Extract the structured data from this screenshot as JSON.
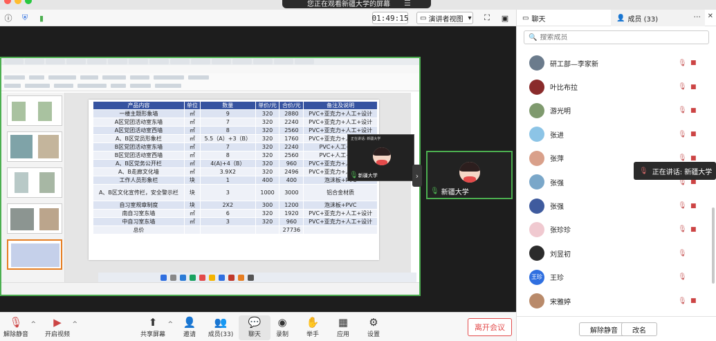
{
  "banner": {
    "text": "您正在观看新疆大学的屏幕"
  },
  "top": {
    "timer": "01:49:15",
    "view_mode": "演讲者视图"
  },
  "slide_table": {
    "headers": [
      "产品内容",
      "单位",
      "数量",
      "单价/元",
      "合价/元",
      "备注及说明"
    ],
    "rows": [
      [
        "一楼主题形象墙",
        "㎡",
        "9",
        "320",
        "2880",
        "PVC+亚克力+人工+设计"
      ],
      [
        "A区党团活动室东墙",
        "㎡",
        "7",
        "320",
        "2240",
        "PVC+亚克力+人工+设计"
      ],
      [
        "A区党团活动室西墙",
        "㎡",
        "8",
        "320",
        "2560",
        "PVC+亚克力+人工+设计"
      ],
      [
        "A、B区党员形象栏",
        "㎡",
        "5.5（A）+3（B）",
        "320",
        "1760",
        "PVC+亚克力+人工+设计"
      ],
      [
        "B区党团活动室东墙",
        "㎡",
        "7",
        "320",
        "2240",
        "PVC+人工+设计"
      ],
      [
        "B区党团活动室西墙",
        "㎡",
        "8",
        "320",
        "2560",
        "PVC+人工+设计"
      ],
      [
        "A、B区党务公开栏",
        "㎡",
        "4(A)+4（B）",
        "320",
        "960",
        "PVC+亚克力+人工+设计"
      ],
      [
        "A、B走廊文化墙",
        "㎡",
        "3.9X2",
        "320",
        "2496",
        "PVC+亚克力+人工+设计"
      ],
      [
        "工作人员形象栏",
        "块",
        "1",
        "400",
        "400",
        "泡沫板+PVC"
      ],
      [
        "A、B区文化宣传栏，安全警示栏",
        "块",
        "3",
        "1000",
        "3000",
        "铝合金材质"
      ],
      [
        "自习室规章制度",
        "块",
        "2X2",
        "300",
        "1200",
        "泡沫板+PVC"
      ],
      [
        "南自习室东墙",
        "㎡",
        "6",
        "320",
        "1920",
        "PVC+亚克力+人工+设计"
      ],
      [
        "中自习室东墙",
        "㎡",
        "3",
        "320",
        "960",
        "PVC+亚克力+人工+设计"
      ],
      [
        "总价",
        "",
        "",
        "",
        "27736",
        ""
      ]
    ]
  },
  "mini_cam": {
    "label": "正在讲话: 新疆大学",
    "name": "新疆大学"
  },
  "cam_tile": {
    "name": "新疆大学"
  },
  "toolbar": {
    "unmute": "解除静音",
    "video": "开启视频",
    "share": "共享屏幕",
    "invite": "邀请",
    "members": "成员(33)",
    "chat": "聊天",
    "record": "录制",
    "hand": "举手",
    "apps": "应用",
    "settings": "设置",
    "leave": "离开会议"
  },
  "side": {
    "tab_chat": "聊天",
    "tab_members": "成员 (33)",
    "search_placeholder": "搜索成员",
    "members": [
      {
        "name": "研工部—李家新",
        "color": "#6b7b8c"
      },
      {
        "name": "叶比布拉",
        "color": "#8a2b2b"
      },
      {
        "name": "游光明",
        "color": "#7f9a6e"
      },
      {
        "name": "张进",
        "color": "#8cc4e6"
      },
      {
        "name": "张萍",
        "color": "#d9a08a"
      },
      {
        "name": "张强",
        "color": "#7aa7c9"
      },
      {
        "name": "张强",
        "color": "#3f5b9e"
      },
      {
        "name": "张珍珍",
        "color": "#f0c9d0"
      },
      {
        "name": "刘昱初",
        "color": "#2b2b2b"
      },
      {
        "name": "王珍",
        "color": "#2f6fe0",
        "initials": "王珍"
      },
      {
        "name": "宋雅婷",
        "color": "#b98a6a"
      }
    ],
    "btn_unmute": "解除静音",
    "btn_rename": "改名"
  },
  "speaking_tip": "正在讲话: 新疆大学"
}
